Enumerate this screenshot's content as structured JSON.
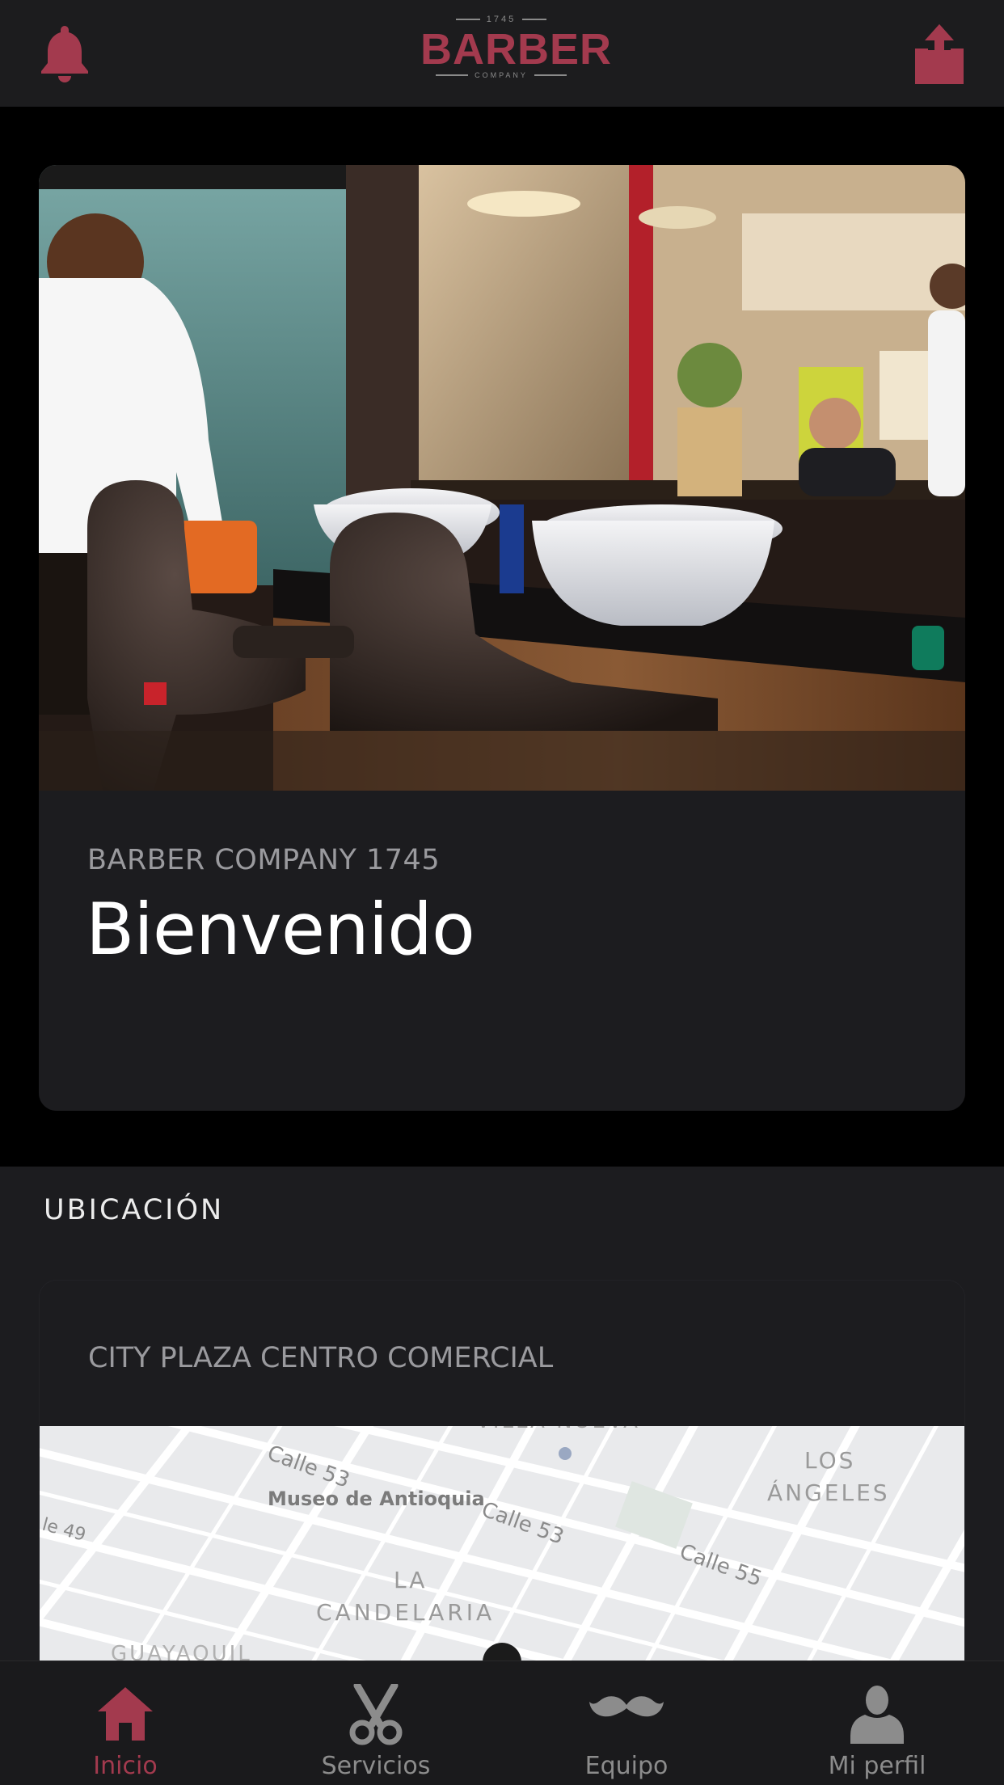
{
  "header": {
    "logo": {
      "year": "1745",
      "word": "BARBER",
      "tagline": "COMPANY"
    }
  },
  "hero": {
    "subtitle": "BARBER COMPANY 1745",
    "title": "Bienvenido"
  },
  "location": {
    "heading": "UBICACIÓN",
    "place_name": "CITY PLAZA CENTRO COMERCIAL",
    "map_labels": {
      "calle53_a": "Calle 53",
      "museo": "Museo de Antioquia",
      "calle53_b": "Calle 53",
      "calle55": "Calle 55",
      "los_angeles_1": "LOS",
      "los_angeles_2": "ÁNGELES",
      "la": "LA",
      "candelaria": "CANDELARIA",
      "guayaquil": "GUAYAQUIL",
      "calle49": "le 49",
      "villa_nueva": "VILLA NUEVA"
    }
  },
  "tabs": [
    {
      "label": "Inicio",
      "icon": "home-icon",
      "active": true
    },
    {
      "label": "Servicios",
      "icon": "scissors-icon",
      "active": false
    },
    {
      "label": "Equipo",
      "icon": "mustache-icon",
      "active": false
    },
    {
      "label": "Mi perfil",
      "icon": "user-icon",
      "active": false
    }
  ],
  "colors": {
    "accent": "#a33a4e",
    "background": "#000000",
    "card": "#1c1c1f",
    "tab_inactive": "#8c8c8c"
  }
}
